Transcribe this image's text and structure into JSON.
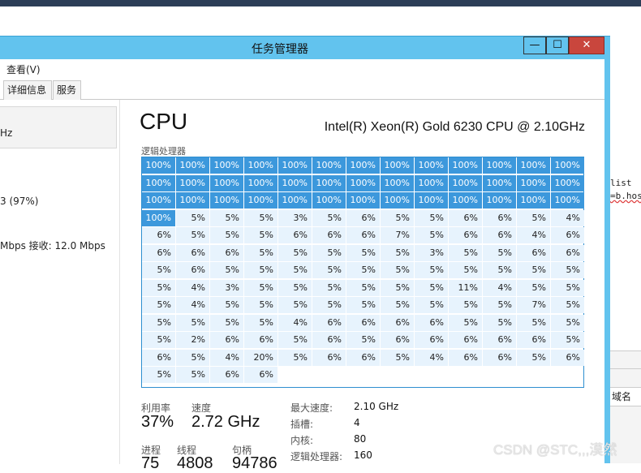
{
  "window": {
    "title": "任务管理器",
    "min_label": "—",
    "max_label": "☐",
    "close_label": "✕"
  },
  "menu": {
    "view": "查看(V)"
  },
  "tabs": [
    {
      "label": "详细信息"
    },
    {
      "label": "服务"
    }
  ],
  "left_pane": {
    "cpu_speed_partial": "Hz",
    "memory_partial": "3 (97%)",
    "ethernet_partial": "Mbps  接收: 12.0 Mbps"
  },
  "cpu": {
    "title": "CPU",
    "model": "Intel(R) Xeon(R) Gold 6230 CPU @ 2.10GHz",
    "grid_label": "逻辑处理器",
    "processors": [
      "100%",
      "100%",
      "100%",
      "100%",
      "100%",
      "100%",
      "100%",
      "100%",
      "100%",
      "100%",
      "100%",
      "100%",
      "100%",
      "100%",
      "100%",
      "100%",
      "100%",
      "100%",
      "100%",
      "100%",
      "100%",
      "100%",
      "100%",
      "100%",
      "100%",
      "100%",
      "100%",
      "100%",
      "100%",
      "100%",
      "100%",
      "100%",
      "100%",
      "100%",
      "100%",
      "100%",
      "100%",
      "100%",
      "100%",
      "100%",
      "5%",
      "5%",
      "5%",
      "3%",
      "5%",
      "6%",
      "5%",
      "5%",
      "6%",
      "6%",
      "5%",
      "4%",
      "6%",
      "5%",
      "5%",
      "5%",
      "6%",
      "6%",
      "6%",
      "7%",
      "5%",
      "6%",
      "6%",
      "4%",
      "6%",
      "6%",
      "6%",
      "6%",
      "5%",
      "5%",
      "5%",
      "5%",
      "5%",
      "3%",
      "5%",
      "5%",
      "6%",
      "6%",
      "5%",
      "6%",
      "5%",
      "5%",
      "5%",
      "5%",
      "5%",
      "5%",
      "5%",
      "5%",
      "5%",
      "5%",
      "5%",
      "5%",
      "4%",
      "3%",
      "5%",
      "5%",
      "5%",
      "5%",
      "5%",
      "5%",
      "11%",
      "4%",
      "5%",
      "5%",
      "5%",
      "4%",
      "5%",
      "5%",
      "5%",
      "5%",
      "5%",
      "5%",
      "5%",
      "5%",
      "5%",
      "7%",
      "5%",
      "5%",
      "5%",
      "5%",
      "5%",
      "4%",
      "6%",
      "6%",
      "6%",
      "6%",
      "5%",
      "5%",
      "5%",
      "5%",
      "5%",
      "2%",
      "6%",
      "6%",
      "5%",
      "6%",
      "5%",
      "6%",
      "6%",
      "6%",
      "6%",
      "6%",
      "5%",
      "6%",
      "5%",
      "4%",
      "20%",
      "5%",
      "6%",
      "6%",
      "5%",
      "4%",
      "6%",
      "6%",
      "5%",
      "6%",
      "5%",
      "5%",
      "6%",
      "6%"
    ]
  },
  "stats": {
    "utilization_label": "利用率",
    "utilization_value": "37%",
    "speed_label": "速度",
    "speed_value": "2.72 GHz",
    "processes_label": "进程",
    "processes_value": "75",
    "threads_label": "线程",
    "threads_value": "4808",
    "handles_label": "句柄",
    "handles_value": "94786",
    "max_speed_label": "最大速度:",
    "max_speed_value": "2.10 GHz",
    "sockets_label": "插槽:",
    "sockets_value": "4",
    "cores_label": "内核:",
    "cores_value": "80",
    "logical_label": "逻辑处理器:",
    "logical_value": "160"
  },
  "background": {
    "code_line1": "list",
    "code_line2": "=b.hos",
    "column_header": "域名"
  },
  "watermark": "CSDN @STC,,,漠然"
}
